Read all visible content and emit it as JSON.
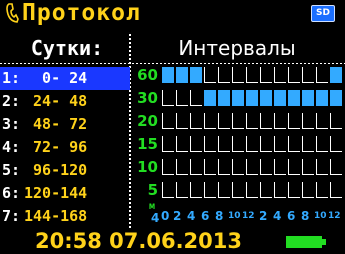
{
  "header": {
    "title": "Протокол",
    "sd_label": "SD"
  },
  "columns": {
    "left": "Сутки:",
    "right": "Интервалы"
  },
  "rows": [
    {
      "num": "1:",
      "range": "  0- 24"
    },
    {
      "num": "2:",
      "range": " 24- 48"
    },
    {
      "num": "3:",
      "range": " 48- 72"
    },
    {
      "num": "4:",
      "range": " 72- 96"
    },
    {
      "num": "5:",
      "range": " 96-120"
    },
    {
      "num": "6:",
      "range": "120-144"
    },
    {
      "num": "7:",
      "range": "144-168"
    }
  ],
  "selected_row": 0,
  "chart": {
    "y_labels": [
      "60",
      "30",
      "20",
      "15",
      "10",
      "5"
    ],
    "y_unit": "м",
    "x_labels": [
      "4",
      "0",
      "2",
      "4",
      "6",
      "8",
      "10",
      "12",
      "2",
      "4",
      "6",
      "8",
      "10",
      "12"
    ],
    "filled": [
      [
        1,
        1,
        1,
        0,
        0,
        0,
        0,
        0,
        0,
        0,
        0,
        0,
        1
      ],
      [
        0,
        0,
        0,
        1,
        1,
        1,
        1,
        1,
        1,
        1,
        1,
        1,
        1
      ]
    ]
  },
  "footer": {
    "datetime": "20:58 07.06.2013"
  },
  "colors": {
    "accent": "#ffd21a",
    "selected": "#1a38ff",
    "grid": "#22dd22",
    "bar": "#33aaff"
  }
}
